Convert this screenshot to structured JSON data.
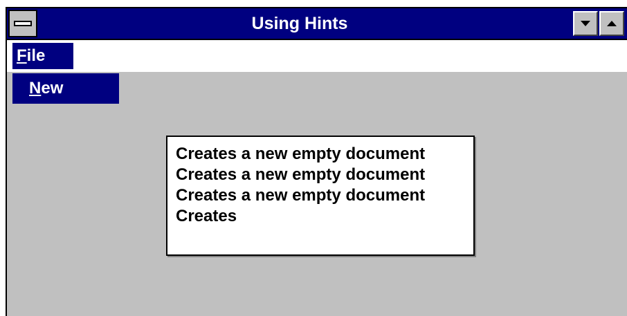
{
  "window": {
    "title": "Using Hints",
    "sysmenu_icon": "system-menu-bar-icon",
    "minimize_icon": "triangle-down-icon",
    "maximize_icon": "triangle-up-icon"
  },
  "menubar": {
    "file_accel": "F",
    "file_rest": "ile"
  },
  "dropdown": {
    "new_accel": "N",
    "new_rest": "ew"
  },
  "hint": {
    "text": "Creates a new empty document Creates a new empty document Creates a new empty document Creates"
  },
  "colors": {
    "titlebar": "#000080",
    "highlight": "#000080",
    "client": "#c0c0c0",
    "menubar": "#ffffff"
  }
}
